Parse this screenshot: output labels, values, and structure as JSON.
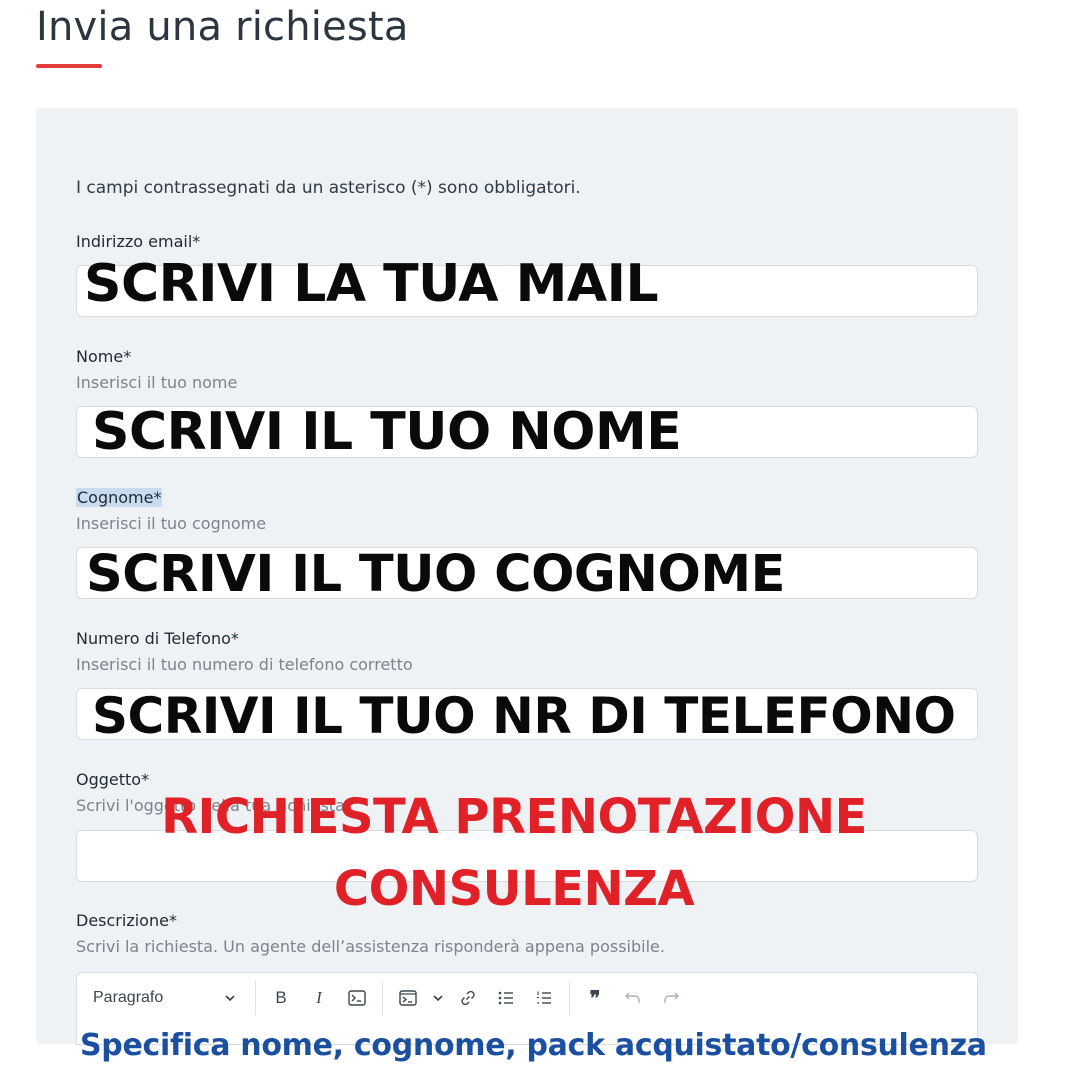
{
  "page": {
    "title": "Invia una richiesta",
    "accent_color": "#e33b3b"
  },
  "form": {
    "required_note": "I campi contrassegnati da un asterisco (*) sono obbligatori.",
    "email": {
      "label": "Indirizzo email*",
      "value": ""
    },
    "nome": {
      "label": "Nome*",
      "help": "Inserisci il tuo nome",
      "value": ""
    },
    "cognome": {
      "label": "Cognome*",
      "help": "Inserisci il tuo cognome",
      "value": ""
    },
    "telefono": {
      "label": "Numero di Telefono*",
      "help": "Inserisci il tuo numero di telefono corretto",
      "value": ""
    },
    "oggetto": {
      "label": "Oggetto*",
      "help": "Scrivi l'oggetto della tua richiesta",
      "value": ""
    },
    "descrizione": {
      "label": "Descrizione*",
      "help": "Scrivi la richiesta. Un agente dell’assistenza risponderà appena possibile.",
      "toolbar": {
        "paragraph_select": "Paragrafo",
        "icons": [
          "bold-icon",
          "italic-icon",
          "code-icon",
          "code-block-icon",
          "link-icon",
          "bullet-list-icon",
          "numbered-list-icon",
          "blockquote-icon",
          "undo-icon",
          "redo-icon"
        ]
      }
    }
  },
  "overlays": {
    "email": "SCRIVI LA TUA MAIL",
    "nome": "SCRIVI IL TUO NOME",
    "cognome": "SCRIVI IL TUO COGNOME",
    "telefono": "SCRIVI IL TUO NR DI TELEFONO",
    "oggetto_line1": "RICHIESTA PRENOTAZIONE",
    "oggetto_line2": "CONSULENZA",
    "descrizione": "Specifica nome, cognome, pack acquistato/consulenza",
    "colors": {
      "black": "#0a0a0a",
      "red": "#e02128",
      "blue": "#1b4fa0"
    }
  }
}
